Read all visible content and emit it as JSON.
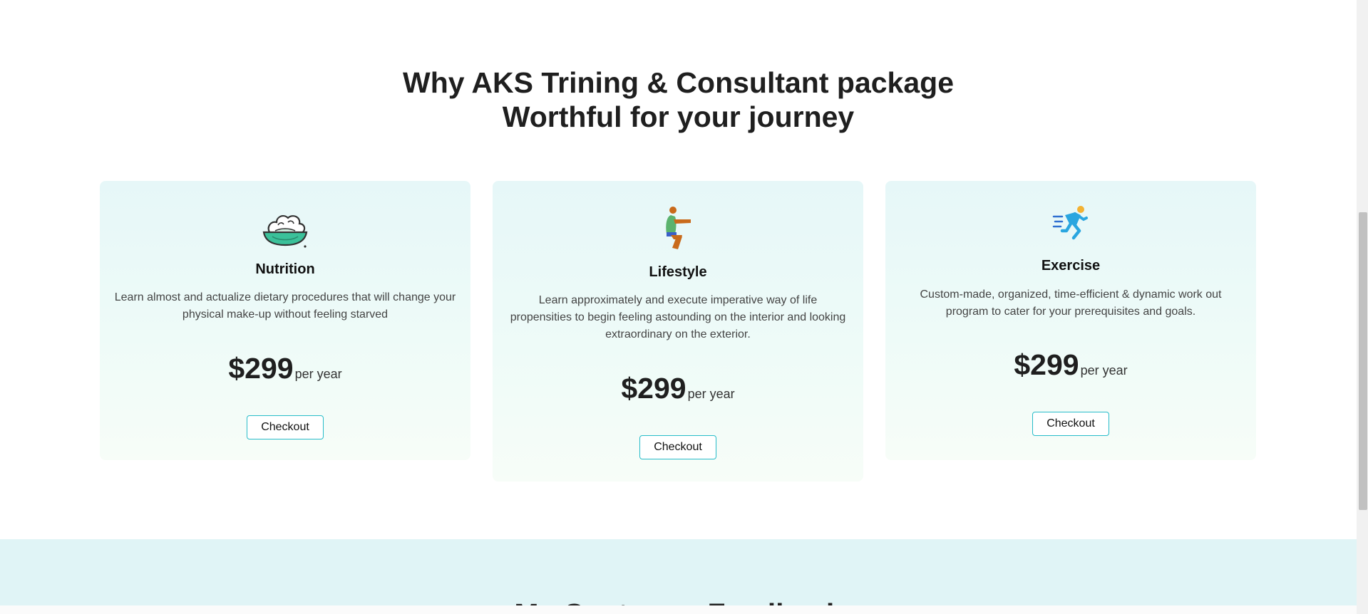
{
  "section": {
    "title_line1": "Why AKS Trining & Consultant package",
    "title_line2": "Worthful for your journey"
  },
  "cards": [
    {
      "icon": "cauliflower-bowl-icon",
      "title": "Nutrition",
      "description": "Learn almost and actualize dietary procedures that will change your physical make-up without feeling starved",
      "price": "$299",
      "period": "per year",
      "button": "Checkout"
    },
    {
      "icon": "squatting-person-icon",
      "title": "Lifestyle",
      "description": "Learn approximately and execute imperative way of life propensities to begin feeling astounding on the interior and looking extraordinary on the exterior.",
      "price": "$299",
      "period": "per year",
      "button": "Checkout"
    },
    {
      "icon": "running-person-icon",
      "title": "Exercise",
      "description": "Custom-made, organized, time-efficient & dynamic work out program to cater for your prerequisites and goals.",
      "price": "$299",
      "period": "per year",
      "button": "Checkout"
    }
  ],
  "feedback": {
    "title": "My Customer Feedback"
  },
  "colors": {
    "accent": "#27bcc9",
    "card_bg_top": "#e6f7f8",
    "feedback_bg": "#e0f4f6"
  }
}
